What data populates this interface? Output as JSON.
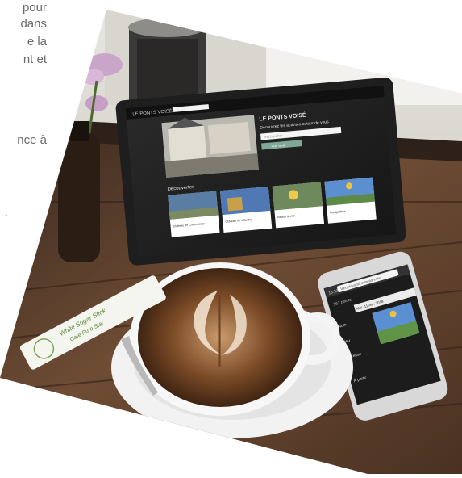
{
  "intro_text": {
    "lines": [
      "pour",
      "dans",
      "e la",
      "nt et",
      "nce à",
      "."
    ]
  },
  "tablet": {
    "brand": "LE PONTS VOISÉ",
    "hero_title": "Découvrez les activités autour de vous",
    "search_placeholder": "Rechercher",
    "search_button": "Voir tout",
    "section_title": "Découvertes",
    "cards": [
      {
        "caption": "Château de Chenonceau"
      },
      {
        "caption": "Château de Villandry"
      },
      {
        "caption": "Balade à vélo"
      },
      {
        "caption": "Montgolfière"
      }
    ]
  },
  "phone": {
    "status": "13:32",
    "url_bar": "lepontsvoisé.com/adresse",
    "date_label": "Mer. 11 Avr. 2018",
    "counter": "162 points",
    "side_labels": [
      "Nom",
      "Lieu",
      "Adresse",
      "À partir"
    ]
  },
  "sugar_packet": {
    "line1": "White Sugar Stick",
    "line2": "Cafe Pure Star"
  },
  "colors": {
    "table": "#6b4a33",
    "tablet_body": "#1e1e1e",
    "coffee": "#5e3a1f",
    "accent_green": "#7cb342"
  }
}
